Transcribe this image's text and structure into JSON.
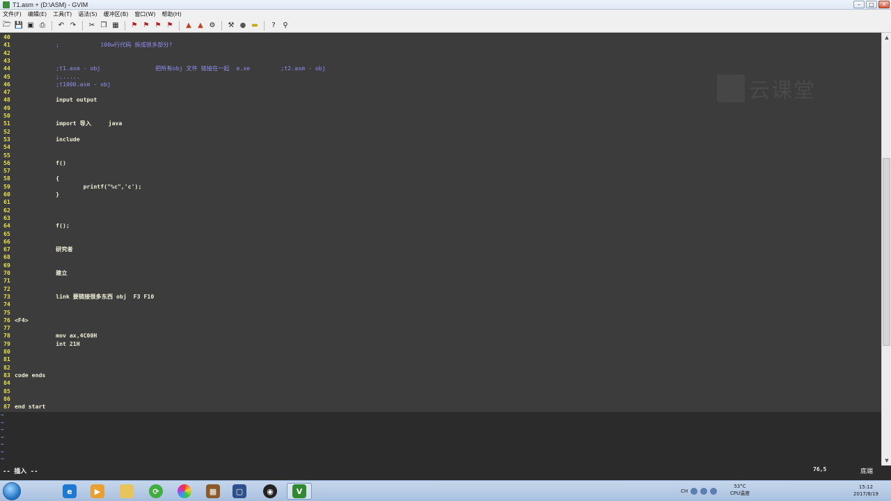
{
  "window": {
    "title": "T1.asm + (D:\\ASM) - GVIM",
    "buttons": [
      "–",
      "□",
      "✕"
    ]
  },
  "menu": [
    "文件(F)",
    "编辑(E)",
    "工具(T)",
    "语法(S)",
    "缓冲区(B)",
    "窗口(W)",
    "帮助(H)"
  ],
  "toolbar_icons": [
    "open-icon",
    "save-icon",
    "save-all-icon",
    "print-icon",
    "undo-icon",
    "redo-icon",
    "cut-icon",
    "copy-icon",
    "paste-icon",
    "find-icon",
    "find-next-icon",
    "find-prev-icon",
    "replace-icon",
    "load-session-icon",
    "save-session-icon",
    "run-script-icon",
    "make-icon",
    "shell-icon",
    "ctags-icon",
    "help-icon",
    "find-help-icon"
  ],
  "lines": [
    {
      "n": "40",
      "text": ""
    },
    {
      "n": "41",
      "text": "            ;            100w行代码 拆成很多部分?"
    },
    {
      "n": "42",
      "text": ""
    },
    {
      "n": "43",
      "text": ""
    },
    {
      "n": "44",
      "text": "            ;t1.asm - obj                把所有obj 文件 链接在一起  e.xe         ;t2.asm - obj"
    },
    {
      "n": "45",
      "text": "            ;......"
    },
    {
      "n": "46",
      "text": "            ;t1000.asm - obj"
    },
    {
      "n": "47",
      "text": ""
    },
    {
      "n": "48",
      "text": "            input output"
    },
    {
      "n": "49",
      "text": ""
    },
    {
      "n": "50",
      "text": ""
    },
    {
      "n": "51",
      "text": "            import 导入     java"
    },
    {
      "n": "52",
      "text": ""
    },
    {
      "n": "53",
      "text": "            include"
    },
    {
      "n": "54",
      "text": ""
    },
    {
      "n": "55",
      "text": ""
    },
    {
      "n": "56",
      "text": "            f()"
    },
    {
      "n": "57",
      "text": ""
    },
    {
      "n": "58",
      "text": "            {"
    },
    {
      "n": "59",
      "text": "                    printf(\"%c\",'c');"
    },
    {
      "n": "60",
      "text": "            }"
    },
    {
      "n": "61",
      "text": ""
    },
    {
      "n": "62",
      "text": ""
    },
    {
      "n": "63",
      "text": ""
    },
    {
      "n": "64",
      "text": "            f();"
    },
    {
      "n": "65",
      "text": ""
    },
    {
      "n": "66",
      "text": ""
    },
    {
      "n": "67",
      "text": "            研究者"
    },
    {
      "n": "68",
      "text": ""
    },
    {
      "n": "69",
      "text": ""
    },
    {
      "n": "70",
      "text": "            建立"
    },
    {
      "n": "71",
      "text": ""
    },
    {
      "n": "72",
      "text": ""
    },
    {
      "n": "73",
      "text": "            link 要链接很多东西 obj  F3 F10"
    },
    {
      "n": "74",
      "text": ""
    },
    {
      "n": "75",
      "text": ""
    },
    {
      "n": "76",
      "text": "<F4>"
    },
    {
      "n": "77",
      "text": ""
    },
    {
      "n": "78",
      "text": "            mov ax,4C00H"
    },
    {
      "n": "79",
      "text": "            int 21H"
    },
    {
      "n": "80",
      "text": ""
    },
    {
      "n": "81",
      "text": ""
    },
    {
      "n": "82",
      "text": ""
    },
    {
      "n": "83",
      "text": "code ends"
    },
    {
      "n": "84",
      "text": ""
    },
    {
      "n": "85",
      "text": ""
    },
    {
      "n": "86",
      "text": ""
    },
    {
      "n": "87",
      "text": "end start"
    }
  ],
  "tilde_count": 7,
  "tilde": "~",
  "watermark": "云课堂",
  "status": {
    "mode": "-- 插入 --",
    "position": "76,5",
    "scroll": "底端"
  },
  "taskbar": {
    "apps": [
      "ie-icon",
      "media-player-icon",
      "explorer-icon",
      "chrome-icon",
      "color-icon",
      "dosbox-icon",
      "virtualbox-icon",
      "obs-icon",
      "gvim-icon"
    ],
    "tray_lang": "CH",
    "cpu_temp": "53°C",
    "cpu_label": "CPU温度",
    "time": "15:12",
    "date": "2017/8/19"
  }
}
